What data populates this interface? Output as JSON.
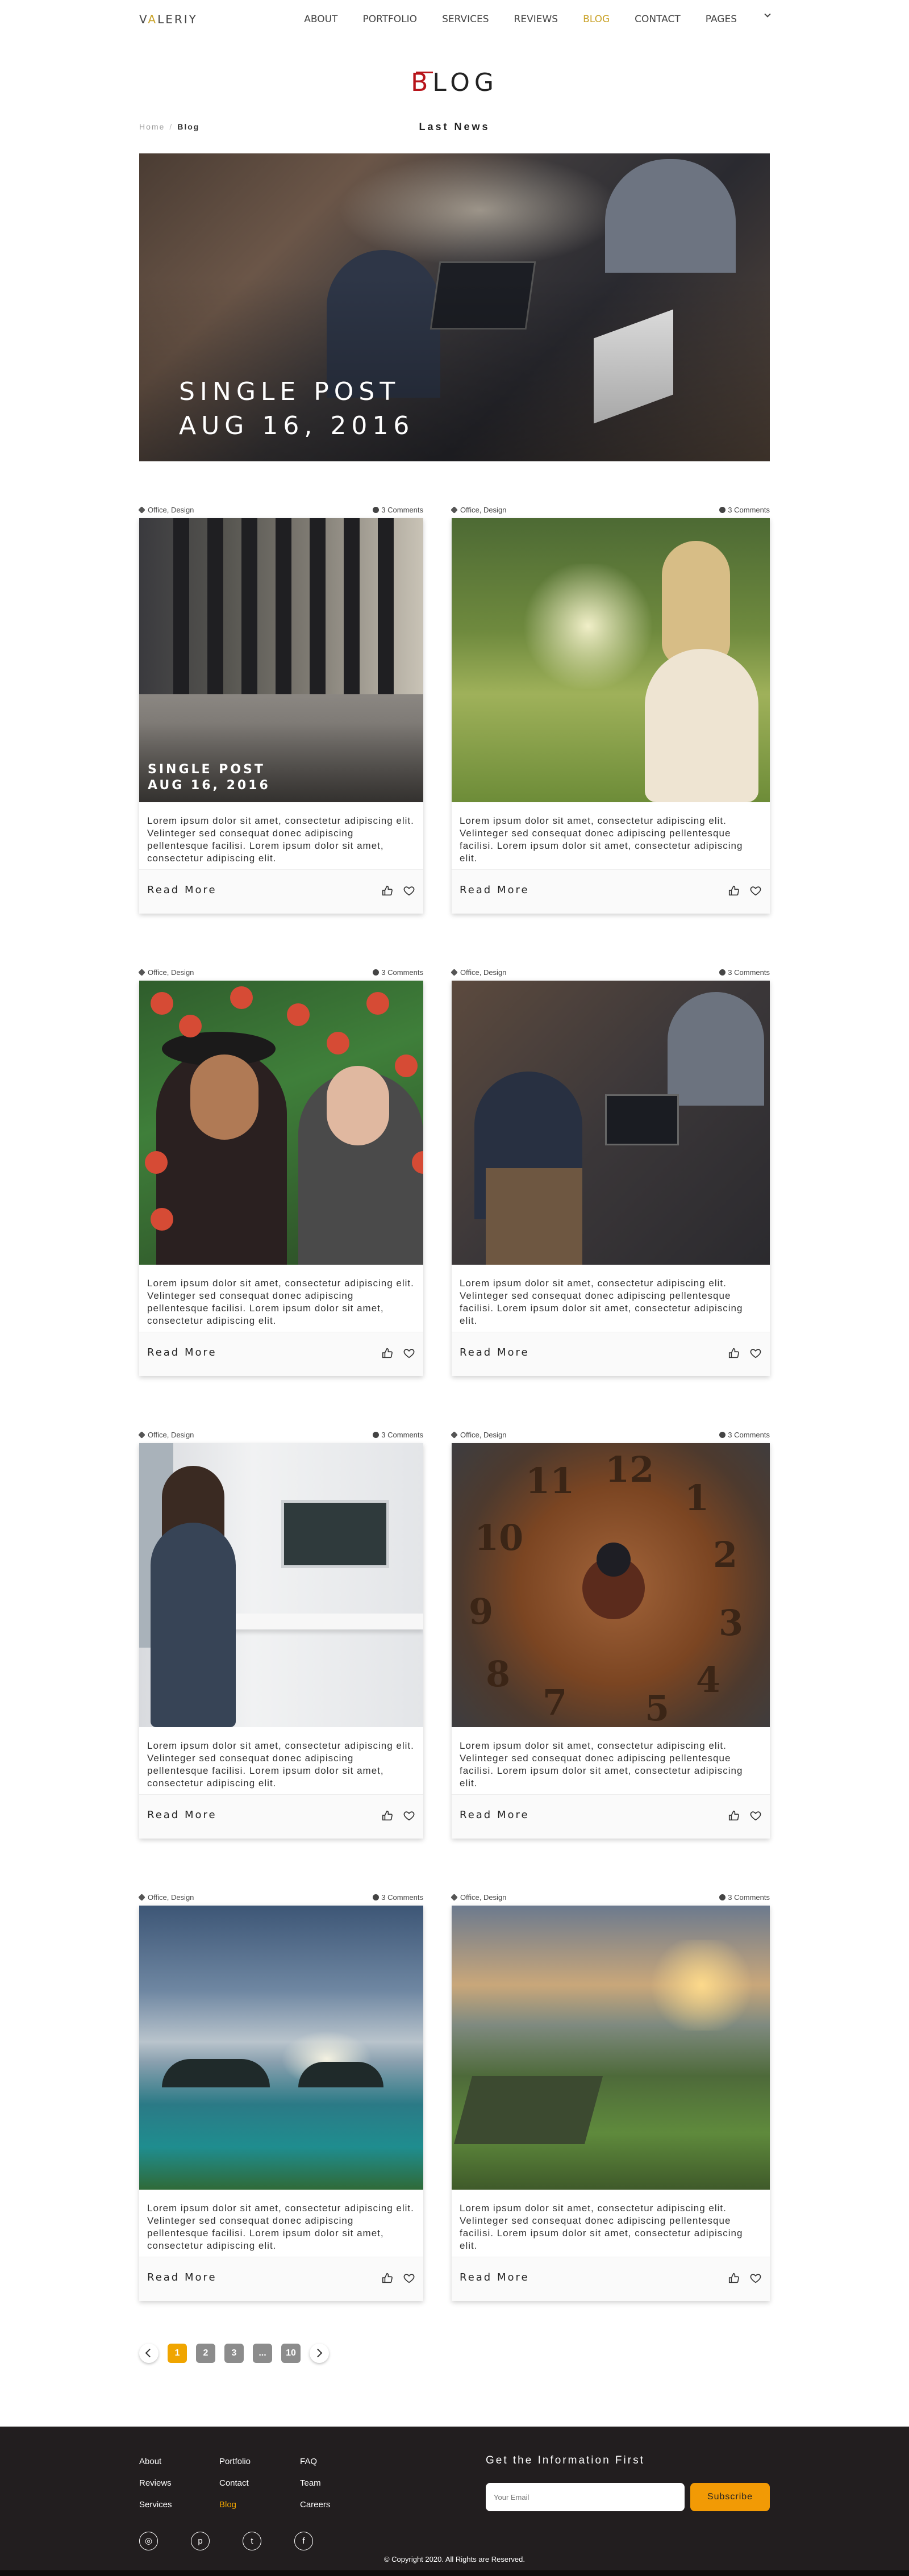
{
  "nav": {
    "logo_first": "V",
    "logo_accent": "A",
    "logo_rest": "LERIY",
    "items": [
      {
        "label": "ABOUT",
        "active": false
      },
      {
        "label": "PORTFOLIO",
        "active": false
      },
      {
        "label": "SERVICES",
        "active": false
      },
      {
        "label": "REVIEWS",
        "active": false
      },
      {
        "label": "BLOG",
        "active": true
      },
      {
        "label": "CONTACT",
        "active": false
      },
      {
        "label": "PAGES",
        "active": false
      }
    ]
  },
  "header": {
    "title_first": "B",
    "title_rest": "LOG",
    "subtitle": "Last News",
    "breadcrumb": {
      "home": "Home",
      "separator": "/",
      "current": "Blog"
    }
  },
  "hero": {
    "caption_line1": "SINGLE POST",
    "caption_line2": "AUG 16, 2016"
  },
  "posts": [
    {
      "category": "Office, Design",
      "comments": "3 Comments",
      "caption_line1": "SINGLE POST",
      "caption_line2": "AUG 16, 2016",
      "excerpt": "Lorem ipsum dolor sit amet, consectetur adipiscing elit. Velinteger sed consequat donec adipiscing pellentesque facilisi. Lorem ipsum dolor sit amet, consectetur adipiscing elit.",
      "read_more": "Read More",
      "image": "office"
    },
    {
      "category": "Office, Design",
      "comments": "3 Comments",
      "excerpt": "Lorem ipsum dolor sit amet, consectetur adipiscing elit. Velinteger sed consequat donec adipiscing pellentesque facilisi. Lorem ipsum dolor sit amet, consectetur adipiscing elit.",
      "read_more": "Read More",
      "image": "reading"
    },
    {
      "category": "Office, Design",
      "comments": "3 Comments",
      "excerpt": "Lorem ipsum dolor sit amet, consectetur adipiscing elit. Velinteger sed consequat donec adipiscing pellentesque facilisi. Lorem ipsum dolor sit amet, consectetur adipiscing elit.",
      "read_more": "Read More",
      "image": "couple"
    },
    {
      "category": "Office, Design",
      "comments": "3 Comments",
      "excerpt": "Lorem ipsum dolor sit amet, consectetur adipiscing elit. Velinteger sed consequat donec adipiscing pellentesque facilisi. Lorem ipsum dolor sit amet, consectetur adipiscing elit.",
      "read_more": "Read More",
      "image": "team"
    },
    {
      "category": "Office, Design",
      "comments": "3 Comments",
      "excerpt": "Lorem ipsum dolor sit amet, consectetur adipiscing elit. Velinteger sed consequat donec adipiscing pellentesque facilisi. Lorem ipsum dolor sit amet, consectetur adipiscing elit.",
      "read_more": "Read More",
      "image": "desk"
    },
    {
      "category": "Office, Design",
      "comments": "3 Comments",
      "excerpt": "Lorem ipsum dolor sit amet, consectetur adipiscing elit. Velinteger sed consequat donec adipiscing pellentesque facilisi. Lorem ipsum dolor sit amet, consectetur adipiscing elit.",
      "read_more": "Read More",
      "image": "clock"
    },
    {
      "category": "Office, Design",
      "comments": "3 Comments",
      "excerpt": "Lorem ipsum dolor sit amet, consectetur adipiscing elit. Velinteger sed consequat donec adipiscing pellentesque facilisi. Lorem ipsum dolor sit amet, consectetur adipiscing elit.",
      "read_more": "Read More",
      "image": "sea"
    },
    {
      "category": "Office, Design",
      "comments": "3 Comments",
      "excerpt": "Lorem ipsum dolor sit amet, consectetur adipiscing elit. Velinteger sed consequat donec adipiscing pellentesque facilisi. Lorem ipsum dolor sit amet, consectetur adipiscing elit.",
      "read_more": "Read More",
      "image": "hills"
    }
  ],
  "pagination": {
    "pages": [
      "1",
      "2",
      "3",
      "...",
      "10"
    ],
    "current": "1"
  },
  "footer": {
    "links": [
      {
        "label": "About",
        "active": false
      },
      {
        "label": "Portfolio",
        "active": false
      },
      {
        "label": "FAQ",
        "active": false
      },
      {
        "label": "Reviews",
        "active": false
      },
      {
        "label": "Contact",
        "active": false
      },
      {
        "label": "Team",
        "active": false
      },
      {
        "label": "Services",
        "active": false
      },
      {
        "label": "Blog",
        "active": true
      },
      {
        "label": "Careers",
        "active": false
      }
    ],
    "newsletter_title": "Get the Information First",
    "email_placeholder": "Your Email",
    "subscribe_label": "Subscribe",
    "social": [
      {
        "icon": "instagram-icon",
        "glyph": "◎"
      },
      {
        "icon": "pinterest-icon",
        "glyph": "p"
      },
      {
        "icon": "twitter-icon",
        "glyph": "t"
      },
      {
        "icon": "facebook-icon",
        "glyph": "f"
      }
    ],
    "copyright": "© Copyright 2020. All Rights are Reserved."
  },
  "colors": {
    "accent": "#c9a227",
    "title_red": "#b7141a",
    "page_active": "#f0a500",
    "subscribe": "#f29a05",
    "footer_bg": "#221e1f"
  }
}
